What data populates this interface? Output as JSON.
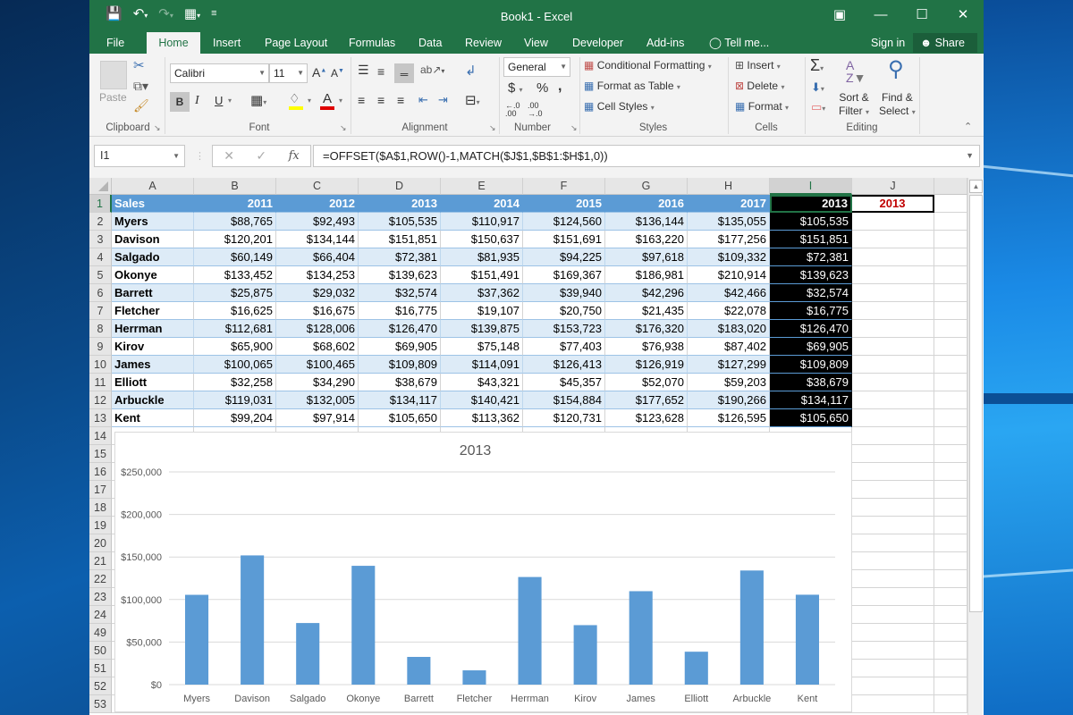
{
  "window": {
    "title": "Book1 - Excel",
    "controls": [
      "ribbon-display-options",
      "minimize",
      "maximize",
      "close"
    ]
  },
  "quick_access": {
    "icons": [
      "save-icon",
      "undo-icon",
      "redo-icon",
      "form-icon",
      "customize-icon"
    ]
  },
  "tabs": [
    {
      "label": "File"
    },
    {
      "label": "Home",
      "active": true
    },
    {
      "label": "Insert"
    },
    {
      "label": "Page Layout"
    },
    {
      "label": "Formulas"
    },
    {
      "label": "Data"
    },
    {
      "label": "Review"
    },
    {
      "label": "View"
    },
    {
      "label": "Developer"
    },
    {
      "label": "Add-ins"
    },
    {
      "label": "Tell me..."
    }
  ],
  "account": {
    "sign_in": "Sign in",
    "share": "Share"
  },
  "ribbon": {
    "clipboard": {
      "label": "Clipboard",
      "paste": "Paste"
    },
    "font": {
      "label": "Font",
      "name": "Calibri",
      "size": "11",
      "bold": "B",
      "italic": "I",
      "underline": "U"
    },
    "alignment": {
      "label": "Alignment"
    },
    "number": {
      "label": "Number",
      "format": "General",
      "currency": "$",
      "percent": "%",
      "comma": ","
    },
    "styles": {
      "label": "Styles",
      "conditional": "Conditional Formatting",
      "format_table": "Format as Table",
      "cell_styles": "Cell Styles"
    },
    "cells": {
      "label": "Cells",
      "insert": "Insert",
      "delete": "Delete",
      "format": "Format"
    },
    "editing": {
      "label": "Editing",
      "sort1": "Sort &",
      "sort2": "Filter",
      "find1": "Find &",
      "find2": "Select"
    }
  },
  "formula_bar": {
    "name_box": "I1",
    "formula": "=OFFSET($A$1,ROW()-1,MATCH($J$1,$B$1:$H$1,0))"
  },
  "sheet": {
    "columns": [
      "A",
      "B",
      "C",
      "D",
      "E",
      "F",
      "G",
      "H",
      "I",
      "J",
      ""
    ],
    "selected_column": "I",
    "header_row": [
      "Sales",
      "2011",
      "2012",
      "2013",
      "2014",
      "2015",
      "2016",
      "2017",
      "2013"
    ],
    "rows": [
      [
        "Myers",
        "$88,765",
        "$92,493",
        "$105,535",
        "$110,917",
        "$124,560",
        "$136,144",
        "$135,055",
        "$105,535"
      ],
      [
        "Davison",
        "$120,201",
        "$134,144",
        "$151,851",
        "$150,637",
        "$151,691",
        "$163,220",
        "$177,256",
        "$151,851"
      ],
      [
        "Salgado",
        "$60,149",
        "$66,404",
        "$72,381",
        "$81,935",
        "$94,225",
        "$97,618",
        "$109,332",
        "$72,381"
      ],
      [
        "Okonye",
        "$133,452",
        "$134,253",
        "$139,623",
        "$151,491",
        "$169,367",
        "$186,981",
        "$210,914",
        "$139,623"
      ],
      [
        "Barrett",
        "$25,875",
        "$29,032",
        "$32,574",
        "$37,362",
        "$39,940",
        "$42,296",
        "$42,466",
        "$32,574"
      ],
      [
        "Fletcher",
        "$16,625",
        "$16,675",
        "$16,775",
        "$19,107",
        "$20,750",
        "$21,435",
        "$22,078",
        "$16,775"
      ],
      [
        "Herrman",
        "$112,681",
        "$128,006",
        "$126,470",
        "$139,875",
        "$153,723",
        "$176,320",
        "$183,020",
        "$126,470"
      ],
      [
        "Kirov",
        "$65,900",
        "$68,602",
        "$69,905",
        "$75,148",
        "$77,403",
        "$76,938",
        "$87,402",
        "$69,905"
      ],
      [
        "James",
        "$100,065",
        "$100,465",
        "$109,809",
        "$114,091",
        "$126,413",
        "$126,919",
        "$127,299",
        "$109,809"
      ],
      [
        "Elliott",
        "$32,258",
        "$34,290",
        "$38,679",
        "$43,321",
        "$45,357",
        "$52,070",
        "$59,203",
        "$38,679"
      ],
      [
        "Arbuckle",
        "$119,031",
        "$132,005",
        "$134,117",
        "$140,421",
        "$154,884",
        "$177,652",
        "$190,266",
        "$134,117"
      ],
      [
        "Kent",
        "$99,204",
        "$97,914",
        "$105,650",
        "$113,362",
        "$120,731",
        "$123,628",
        "$126,595",
        "$105,650"
      ]
    ],
    "j1_value": "2013",
    "row_numbers": [
      "1",
      "2",
      "3",
      "4",
      "5",
      "6",
      "7",
      "8",
      "9",
      "10",
      "11",
      "12",
      "13",
      "14",
      "15",
      "16",
      "17",
      "18",
      "19",
      "20",
      "21",
      "22",
      "23",
      "24",
      "49",
      "50",
      "51",
      "52",
      "53"
    ]
  },
  "chart_data": {
    "type": "bar",
    "title": "2013",
    "categories": [
      "Myers",
      "Davison",
      "Salgado",
      "Okonye",
      "Barrett",
      "Fletcher",
      "Herrman",
      "Kirov",
      "James",
      "Elliott",
      "Arbuckle",
      "Kent"
    ],
    "values": [
      105535,
      151851,
      72381,
      139623,
      32574,
      16775,
      126470,
      69905,
      109809,
      38679,
      134117,
      105650
    ],
    "ylim": [
      0,
      250000
    ],
    "yticks": [
      0,
      50000,
      100000,
      150000,
      200000,
      250000
    ],
    "ytick_labels": [
      "$0",
      "$50,000",
      "$100,000",
      "$150,000",
      "$200,000",
      "$250,000"
    ],
    "xlabel": "",
    "ylabel": "",
    "grid": true,
    "legend": "none",
    "bar_color": "#5b9bd5"
  }
}
